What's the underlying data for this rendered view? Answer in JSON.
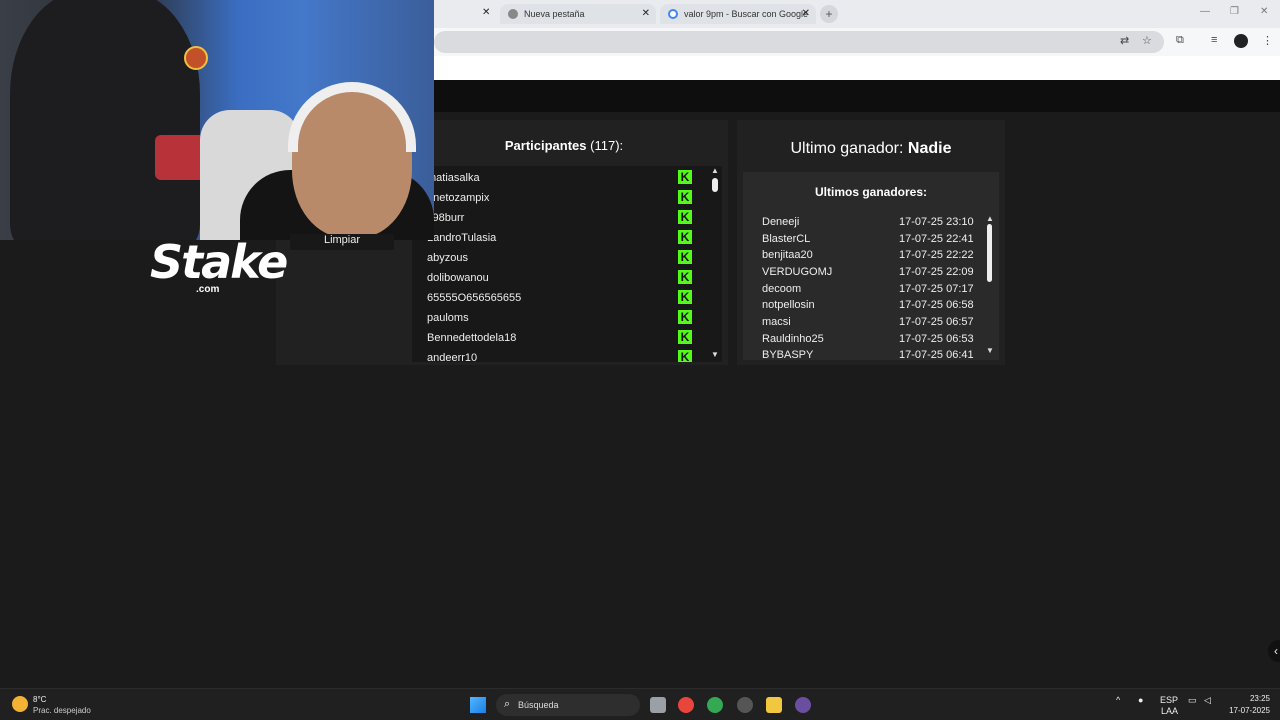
{
  "browser": {
    "tabs": [
      {
        "title": "Nueva pestaña",
        "close": "✕"
      },
      {
        "title": "valor 9pm - Buscar con Google",
        "close": "✕"
      }
    ],
    "first_tab_close": "✕",
    "new_tab": "+"
  },
  "webcam": {
    "clear_button": "Limpiar"
  },
  "logo": {
    "word": "Stake",
    "suffix": ".com"
  },
  "participants": {
    "label": "Participantes",
    "count": "(117):",
    "kick_glyph": "K",
    "items": [
      "matiasalka",
      "anetozampix",
      "k98burr",
      "LandroTulasia",
      "abyzous",
      "dolibowanou",
      "65555O656565655",
      "pauloms",
      "Bennedettodela18",
      "andeerr10"
    ]
  },
  "winner": {
    "label": "Ultimo ganador:",
    "name": "Nadie"
  },
  "winners": {
    "title": "Ultimos ganadores:",
    "items": [
      {
        "name": "Deneeji",
        "date": "17-07-25 23:10"
      },
      {
        "name": "BlasterCL",
        "date": "17-07-25 22:41"
      },
      {
        "name": "benjitaa20",
        "date": "17-07-25 22:22"
      },
      {
        "name": "VERDUGOMJ",
        "date": "17-07-25 22:09"
      },
      {
        "name": "decoom",
        "date": "17-07-25 07:17"
      },
      {
        "name": "notpellosin",
        "date": "17-07-25 06:58"
      },
      {
        "name": "macsi",
        "date": "17-07-25 06:57"
      },
      {
        "name": "Rauldinho25",
        "date": "17-07-25 06:53"
      },
      {
        "name": "BYBASPY",
        "date": "17-07-25 06:41"
      }
    ]
  },
  "taskbar": {
    "temp": "8°C",
    "weather": "Prac. despejado",
    "search": "Búsqueda",
    "lang1": "ESP",
    "lang2": "LAA",
    "time": "23:25",
    "date": "17-07-2025"
  },
  "colors": {
    "kick": "#53fc18",
    "panel": "#212121",
    "background": "#1b1b1b"
  }
}
